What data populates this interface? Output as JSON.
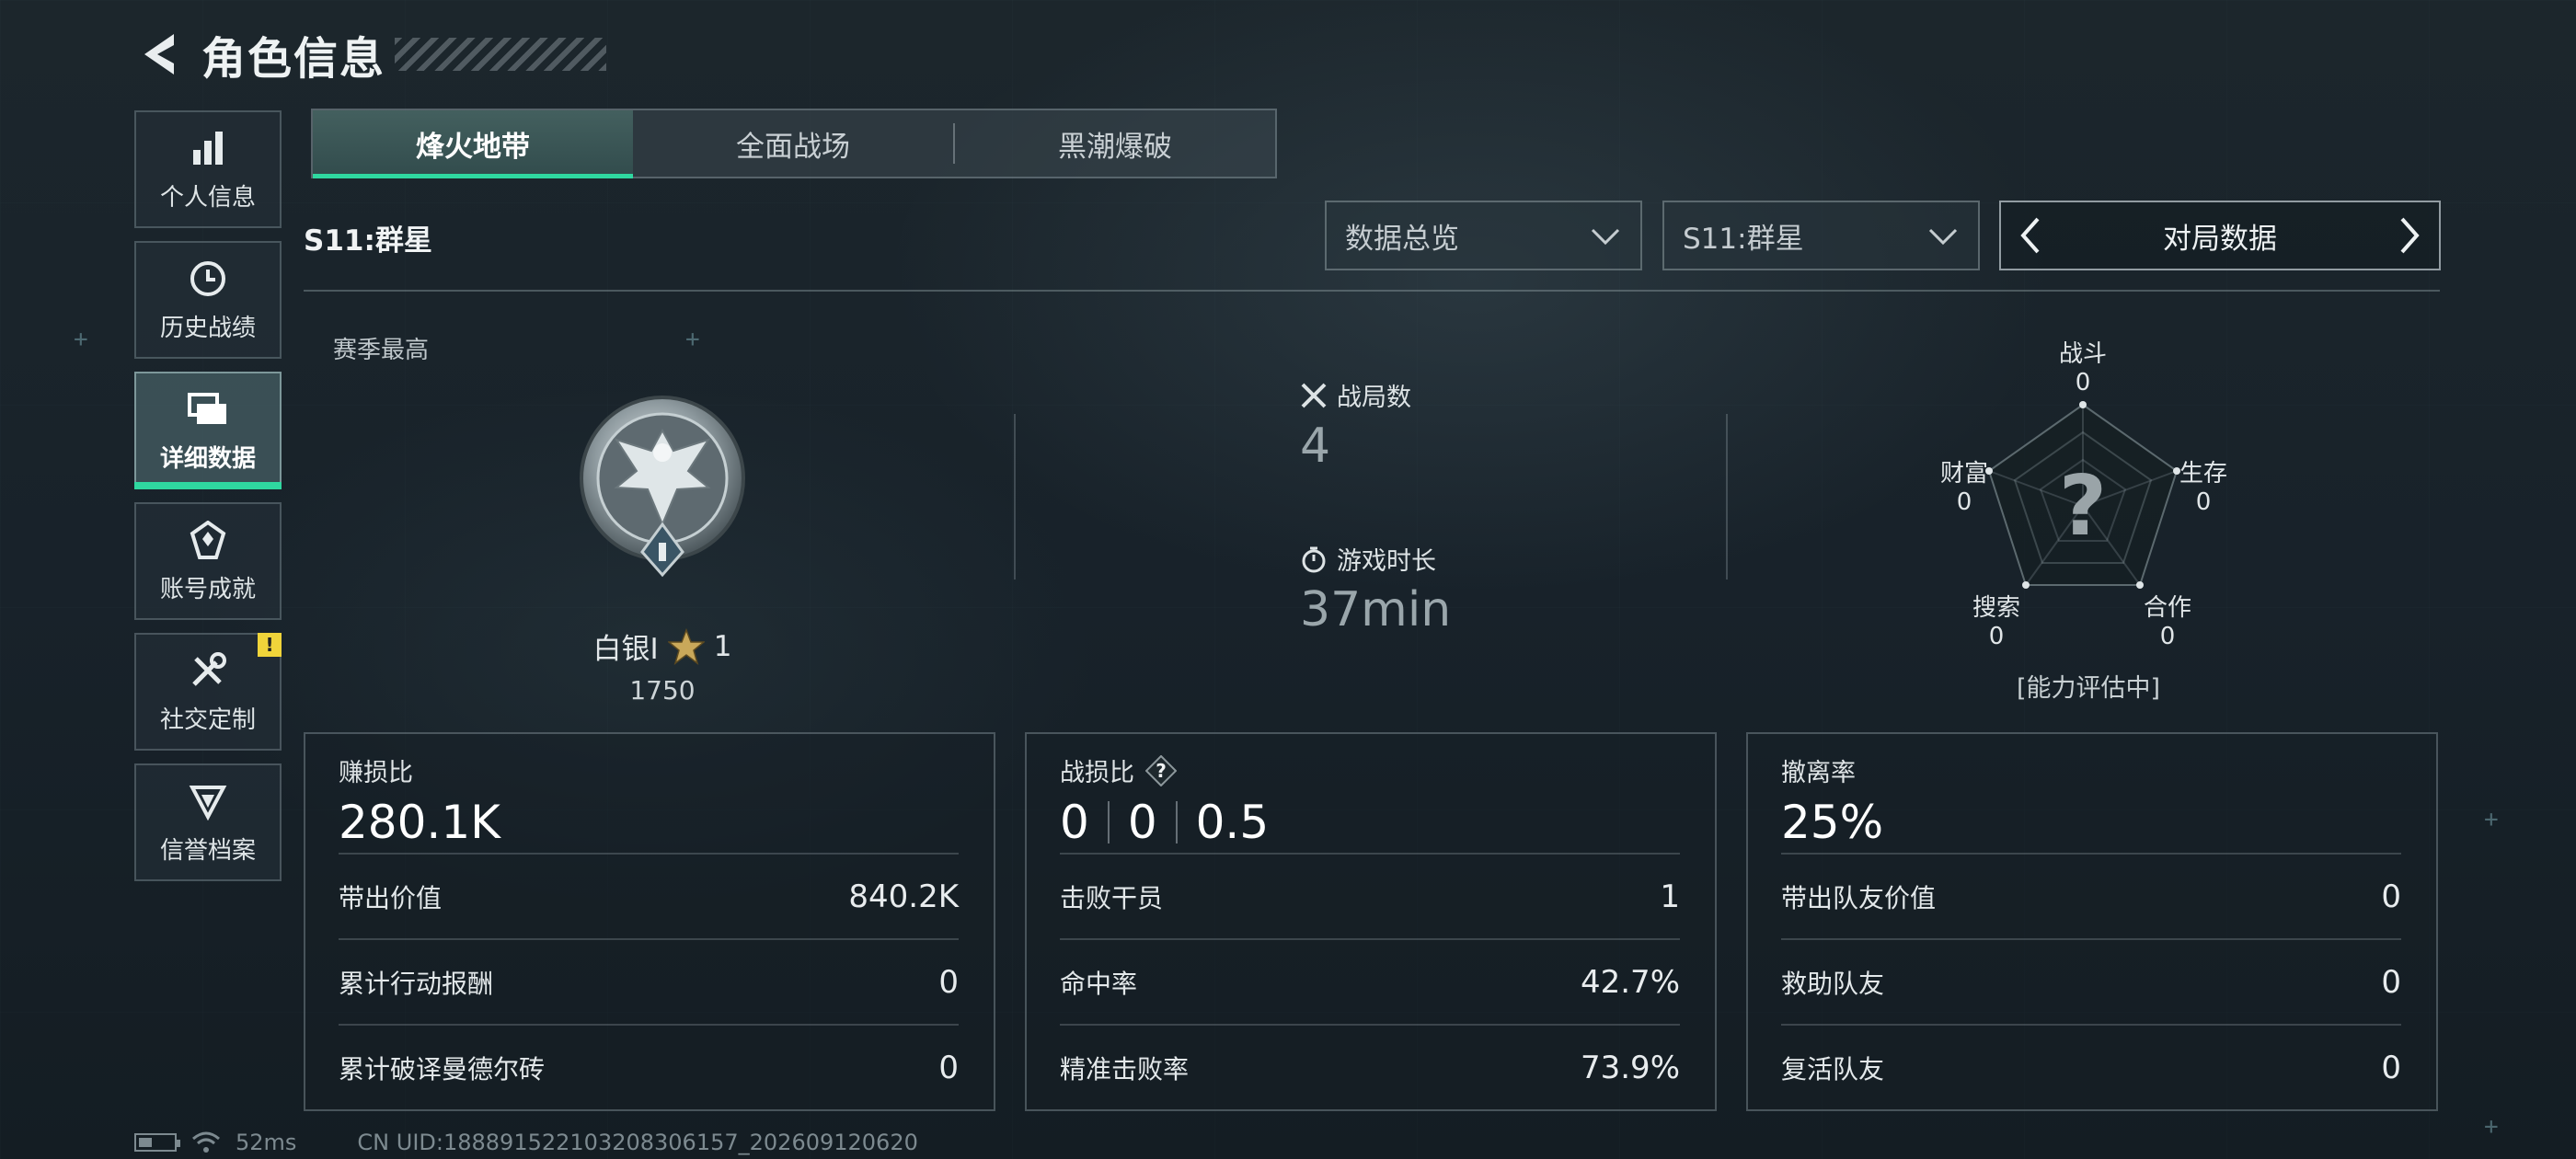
{
  "header": {
    "title": "角色信息"
  },
  "sidebar": {
    "items": [
      {
        "label": "个人信息",
        "icon": "bar-chart-icon",
        "active": false
      },
      {
        "label": "历史战绩",
        "icon": "history-clock-icon",
        "active": false
      },
      {
        "label": "详细数据",
        "icon": "folders-icon",
        "active": true
      },
      {
        "label": "账号成就",
        "icon": "achievement-badge-icon",
        "active": false
      },
      {
        "label": "社交定制",
        "icon": "tools-icon",
        "active": false,
        "badge": "!"
      },
      {
        "label": "信誉档案",
        "icon": "reputation-shield-icon",
        "active": false
      }
    ]
  },
  "mode_tabs": [
    {
      "label": "烽火地带",
      "active": true
    },
    {
      "label": "全面战场",
      "active": false
    },
    {
      "label": "黑潮爆破",
      "active": false
    }
  ],
  "season_title": "S11:群星",
  "filters": {
    "overview_dropdown": "数据总览",
    "season_dropdown": "S11:群星",
    "pager_label": "对局数据"
  },
  "season_best": {
    "label": "赛季最高",
    "rank_name": "白银I",
    "stars": "1",
    "score": "1750"
  },
  "match_stats": {
    "matches_label": "战局数",
    "matches_value": "4",
    "playtime_label": "游戏时长",
    "playtime_value": "37min"
  },
  "radar": {
    "axes": [
      {
        "label": "战斗",
        "value": "0"
      },
      {
        "label": "生存",
        "value": "0"
      },
      {
        "label": "合作",
        "value": "0"
      },
      {
        "label": "搜索",
        "value": "0"
      },
      {
        "label": "财富",
        "value": "0"
      }
    ],
    "center_mark": "?",
    "note": "[能力评估中]"
  },
  "panels": {
    "profit": {
      "label": "赚损比",
      "value": "280.1K",
      "rows": [
        {
          "label": "带出价值",
          "value": "840.2K"
        },
        {
          "label": "累计行动报酬",
          "value": "0"
        },
        {
          "label": "累计破译曼德尔砖",
          "value": "0"
        }
      ]
    },
    "kd": {
      "label": "战损比",
      "values": [
        "0",
        "0",
        "0.5"
      ],
      "rows": [
        {
          "label": "击败干员",
          "value": "1"
        },
        {
          "label": "命中率",
          "value": "42.7%"
        },
        {
          "label": "精准击败率",
          "value": "73.9%"
        }
      ]
    },
    "extract": {
      "label": "撤离率",
      "value": "25%",
      "rows": [
        {
          "label": "带出队友价值",
          "value": "0"
        },
        {
          "label": "救助队友",
          "value": "0"
        },
        {
          "label": "复活队友",
          "value": "0"
        }
      ]
    }
  },
  "footer": {
    "ping": "52ms",
    "uid": "CN UID:18889152210320830​6157_202609120620"
  },
  "colors": {
    "accent": "#2fd8a0",
    "warning": "#f0d43a",
    "background": "#18222a"
  }
}
